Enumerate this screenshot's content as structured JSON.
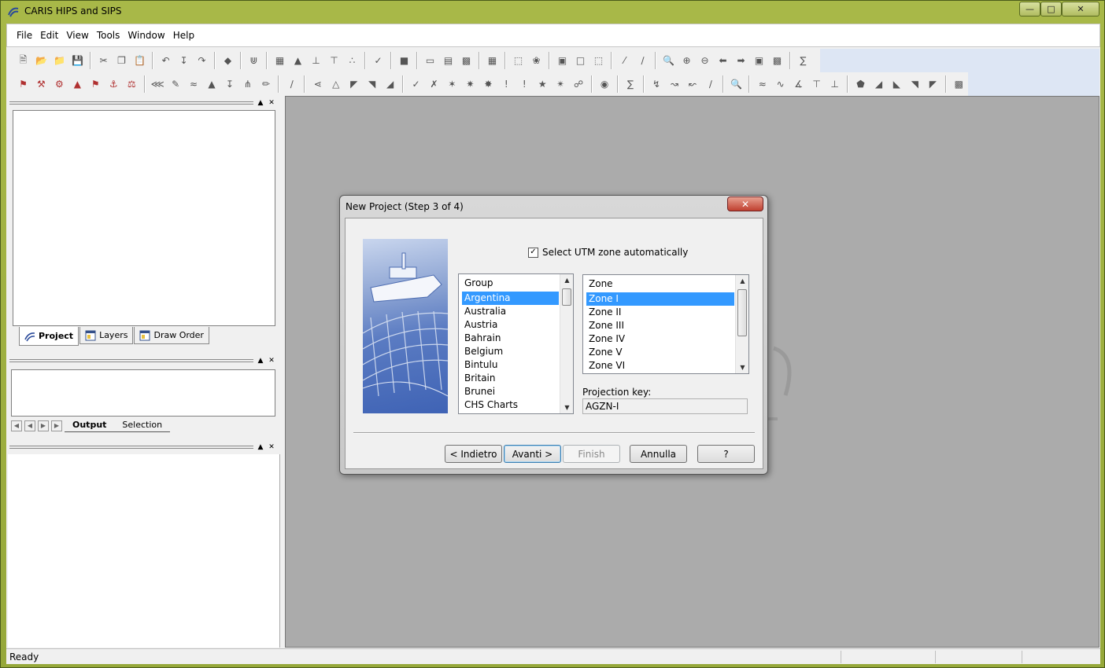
{
  "window": {
    "title": "CARIS HIPS and SIPS"
  },
  "menu": [
    "File",
    "Edit",
    "View",
    "Tools",
    "Window",
    "Help"
  ],
  "project_tabs": [
    "Project",
    "Layers",
    "Draw Order"
  ],
  "output_tabs": [
    "Output",
    "Selection"
  ],
  "status": {
    "text": "Ready"
  },
  "dialog": {
    "title": "New Project (Step 3 of 4)",
    "auto_utm_label": "Select UTM zone automatically",
    "auto_utm_checked": true,
    "group_header": "Group",
    "groups": [
      "Argentina",
      "Australia",
      "Austria",
      "Bahrain",
      "Belgium",
      "Bintulu",
      "Britain",
      "Brunei",
      "CHS Charts"
    ],
    "zone_header": "Zone",
    "zones": [
      "Zone I",
      "Zone II",
      "Zone III",
      "Zone IV",
      "Zone V",
      "Zone VI"
    ],
    "projection_key_label": "Projection key:",
    "projection_key_value": "AGZN-I",
    "buttons": {
      "back": "< Indietro",
      "next": "Avanti >",
      "finish": "Finish",
      "cancel": "Annulla",
      "help": "?"
    }
  },
  "colors": {
    "selection": "#3399ff",
    "title_bar": "#a8b848",
    "workspace": "#ababab"
  }
}
